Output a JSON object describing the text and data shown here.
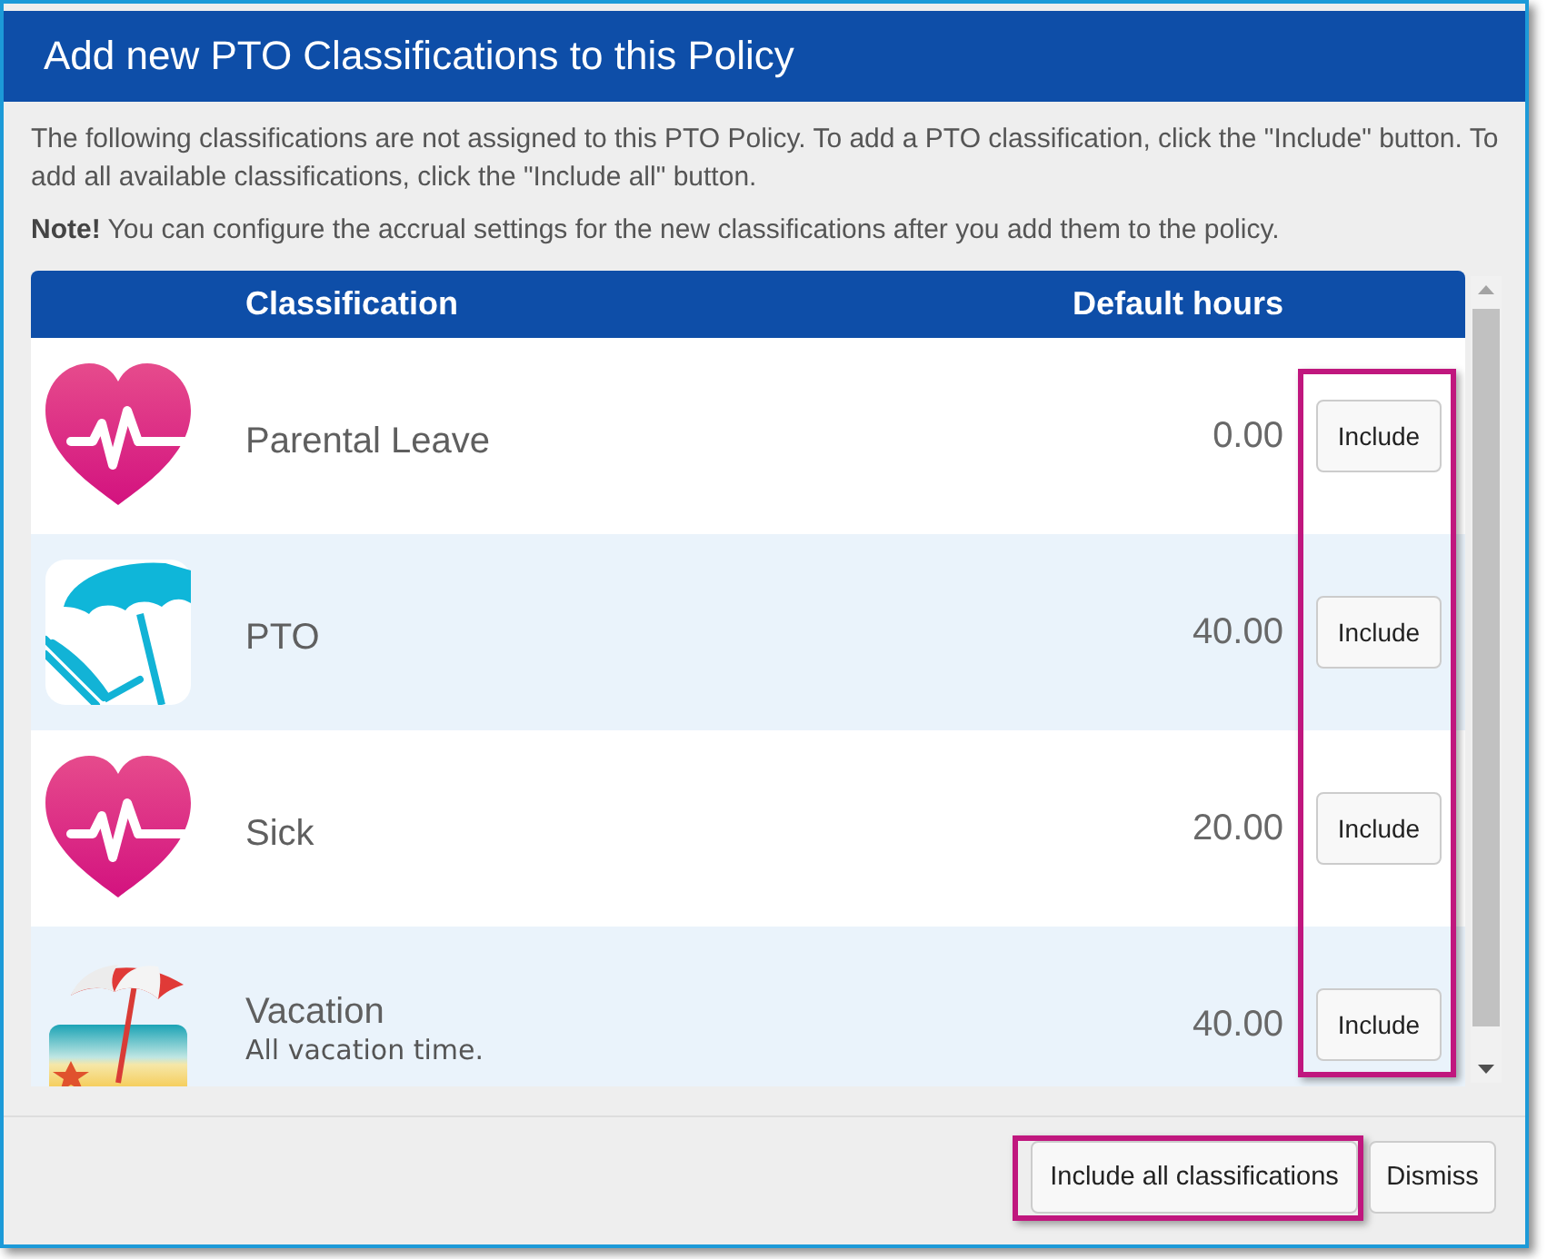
{
  "dialog": {
    "title": "Add new PTO Classifications to this Policy"
  },
  "intro": "The following classifications are not assigned to this PTO Policy. To add a PTO classification, click the \"Include\" button. To add all available classifications, click the \"Include all\" button.",
  "note": "**Note!** You can configure the accrual settings for the new classifications after you add them to the policy.",
  "table": {
    "columns": [
      "Classification",
      "Default hours"
    ],
    "action_column_highlighted": true,
    "rows": [
      {
        "kind": "heart",
        "name": "Parental Leave",
        "default_hours": "0.00",
        "action": "Include"
      },
      {
        "kind": "chair",
        "name": "PTO",
        "default_hours": "40.00",
        "action": "Include"
      },
      {
        "kind": "heart",
        "name": "Sick",
        "default_hours": "20.00",
        "action": "Include"
      },
      {
        "kind": "beach",
        "name": "Vacation",
        "description": "All vacation time.",
        "default_hours": "40.00",
        "action": "Include"
      }
    ]
  },
  "footer": {
    "buttons": [
      {
        "label": "Include all classifications",
        "highlighted": true
      },
      {
        "label": "Dismiss",
        "highlighted": false
      }
    ]
  }
}
